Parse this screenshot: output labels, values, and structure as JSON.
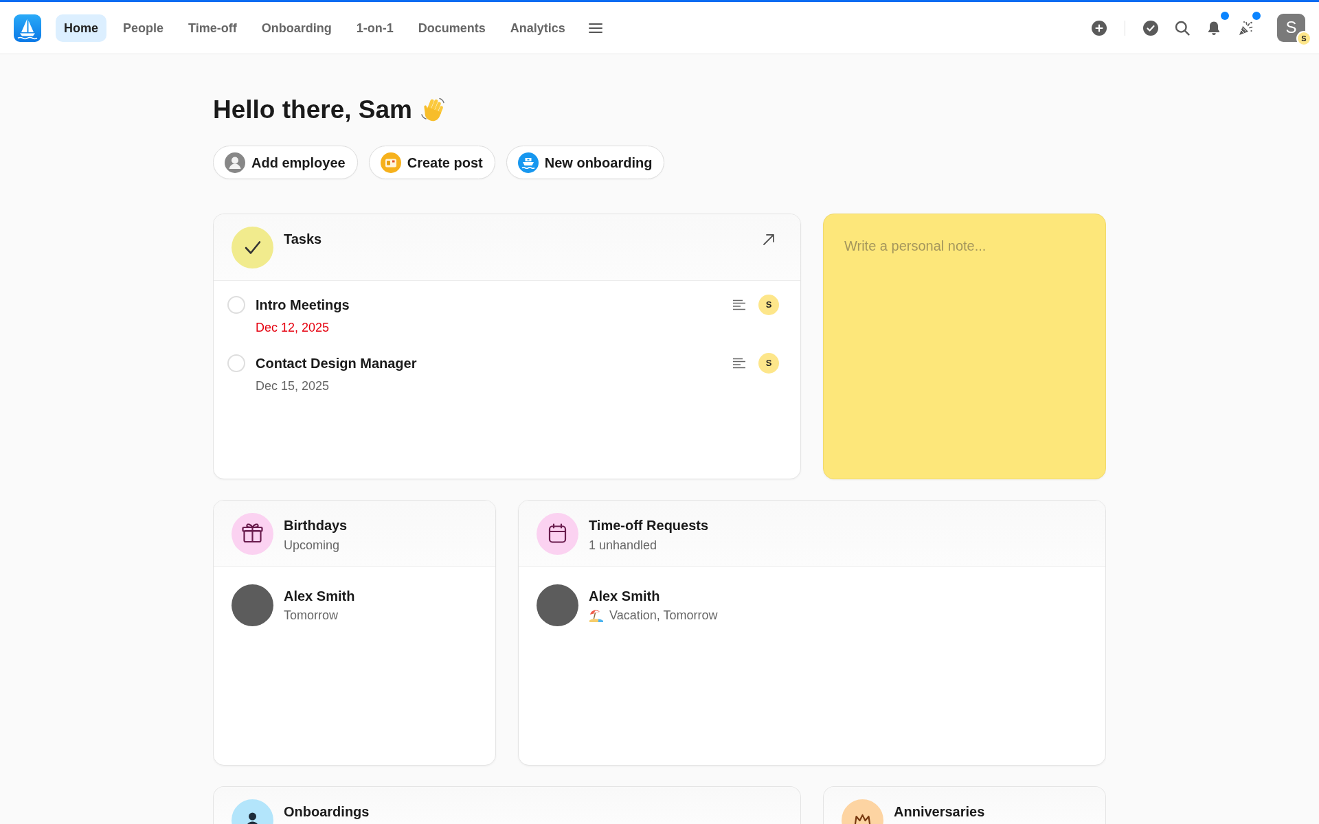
{
  "topbar": {
    "tabs": [
      {
        "label": "Home",
        "selected": true
      },
      {
        "label": "People",
        "selected": false
      },
      {
        "label": "Time-off",
        "selected": false
      },
      {
        "label": "Onboarding",
        "selected": false
      },
      {
        "label": "1-on-1",
        "selected": false
      },
      {
        "label": "Documents",
        "selected": false
      },
      {
        "label": "Analytics",
        "selected": false
      }
    ],
    "actions": [
      {
        "kind": "add",
        "unread": false
      },
      {
        "kind": "tasks",
        "unread": false
      },
      {
        "kind": "search",
        "unread": false
      },
      {
        "kind": "notifications",
        "unread": true
      },
      {
        "kind": "celebrations",
        "unread": true
      }
    ],
    "user": {
      "initial": "S",
      "badge": "S"
    }
  },
  "greeting": "Hello there, Sam",
  "quick_actions": [
    {
      "kind": "employee",
      "label": "Add employee"
    },
    {
      "kind": "post",
      "label": "Create post"
    },
    {
      "kind": "onboarding",
      "label": "New onboarding"
    }
  ],
  "tasks": {
    "title": "Tasks",
    "items": [
      {
        "title": "Intro Meetings",
        "due": "Dec 12, 2025",
        "overdue": true,
        "checked": false,
        "assignee": "S"
      },
      {
        "title": "Contact Design Manager",
        "due": "Dec 15, 2025",
        "overdue": false,
        "checked": false,
        "assignee": "S"
      }
    ]
  },
  "note": {
    "placeholder": "Write a personal note..."
  },
  "birthdays": {
    "title": "Birthdays",
    "subtitle": "Upcoming",
    "entries": [
      {
        "name": "Alex Smith",
        "detail": "Tomorrow"
      }
    ]
  },
  "time_off": {
    "title": "Time-off Requests",
    "subtitle": "1 unhandled",
    "entries": [
      {
        "name": "Alex Smith",
        "detail": "Vacation, Tomorrow",
        "kind": "vacation"
      }
    ]
  },
  "onboardings": {
    "title": "Onboardings"
  },
  "anniversaries": {
    "title": "Anniversaries"
  }
}
